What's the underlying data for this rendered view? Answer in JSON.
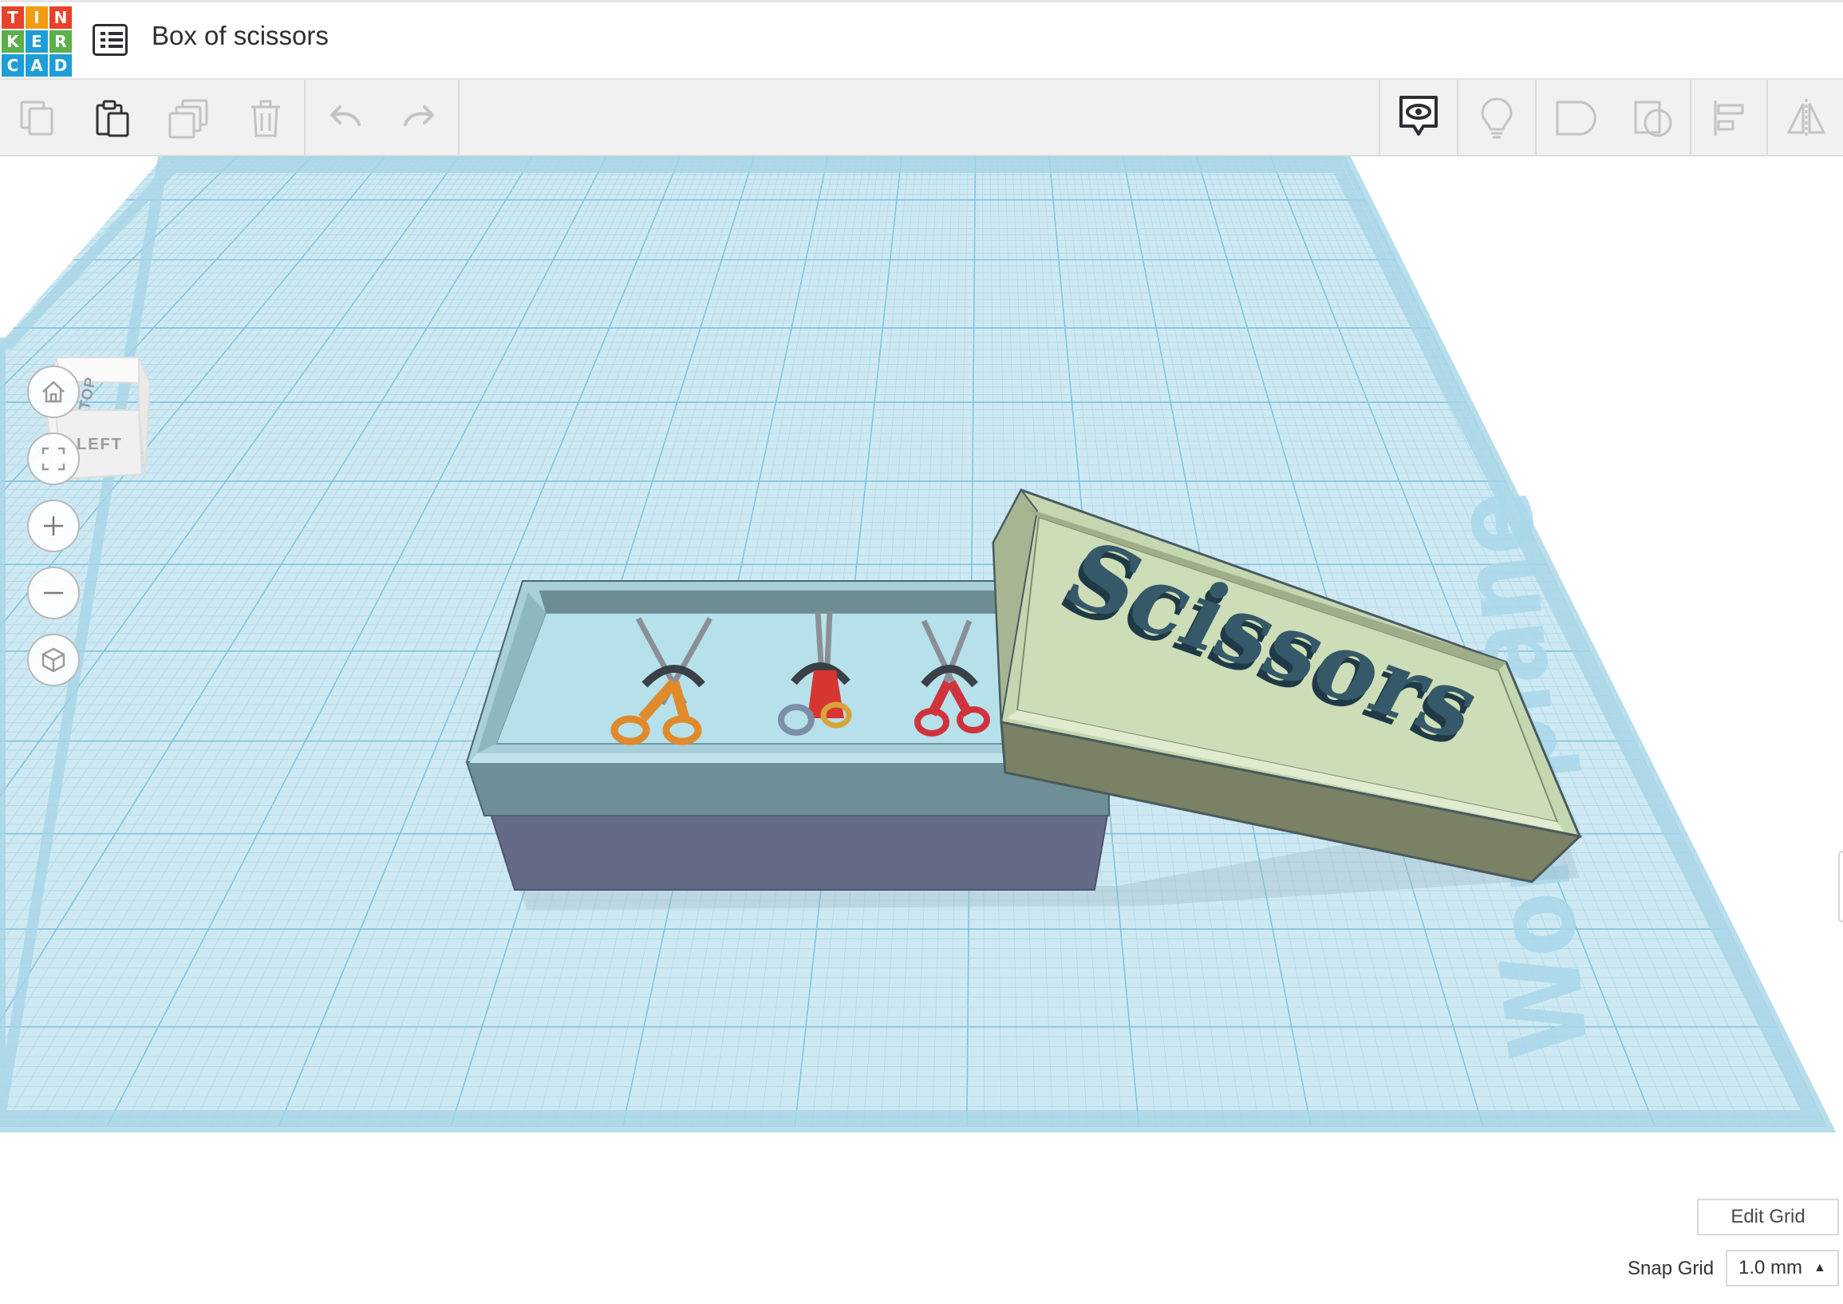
{
  "app": {
    "logo_letters": [
      "T",
      "I",
      "N",
      "K",
      "E",
      "R",
      "C",
      "A",
      "D"
    ],
    "logo_colors": [
      "#e8412c",
      "#f39c12",
      "#e8412c",
      "#5bb04b",
      "#1d9ed9",
      "#5bb04b",
      "#1d9ed9",
      "#1d9ed9",
      "#1d9ed9"
    ],
    "design_title": "Box of scissors"
  },
  "toolbar": {
    "left_tools": [
      {
        "name": "copy-icon",
        "enabled": false
      },
      {
        "name": "paste-icon",
        "enabled": true
      },
      {
        "name": "duplicate-icon",
        "enabled": false
      },
      {
        "name": "delete-icon",
        "enabled": false
      },
      {
        "name": "undo-icon",
        "enabled": false
      },
      {
        "name": "redo-icon",
        "enabled": false
      }
    ],
    "right_tools": [
      {
        "name": "notes-visibility-icon",
        "enabled": true
      },
      {
        "name": "lightbulb-icon",
        "enabled": false
      },
      {
        "name": "group-icon",
        "enabled": false
      },
      {
        "name": "ungroup-icon",
        "enabled": false
      },
      {
        "name": "align-icon",
        "enabled": false
      },
      {
        "name": "mirror-icon",
        "enabled": false
      }
    ]
  },
  "viewcube": {
    "top_label": "TOP",
    "left_label": "LEFT"
  },
  "nav": {
    "buttons": [
      "home-view-icon",
      "fit-all-icon",
      "zoom-in-icon",
      "zoom-out-icon",
      "perspective-icon"
    ]
  },
  "scene": {
    "workplane_label": "Workplane",
    "lid_text": "Scissors",
    "colors": {
      "grid_bg": "#cfe9f3",
      "grid_minor": "#a8d6e8",
      "grid_major": "#7fc2dc",
      "box_top": "#a9d2dc",
      "box_side": "#636b86",
      "lid": "#c8d9b4",
      "lid_side": "#7a8164",
      "text_3d": "#2a4a58"
    }
  },
  "grid_controls": {
    "edit_grid_label": "Edit Grid",
    "snap_grid_label": "Snap Grid",
    "snap_grid_value": "1.0 mm"
  }
}
